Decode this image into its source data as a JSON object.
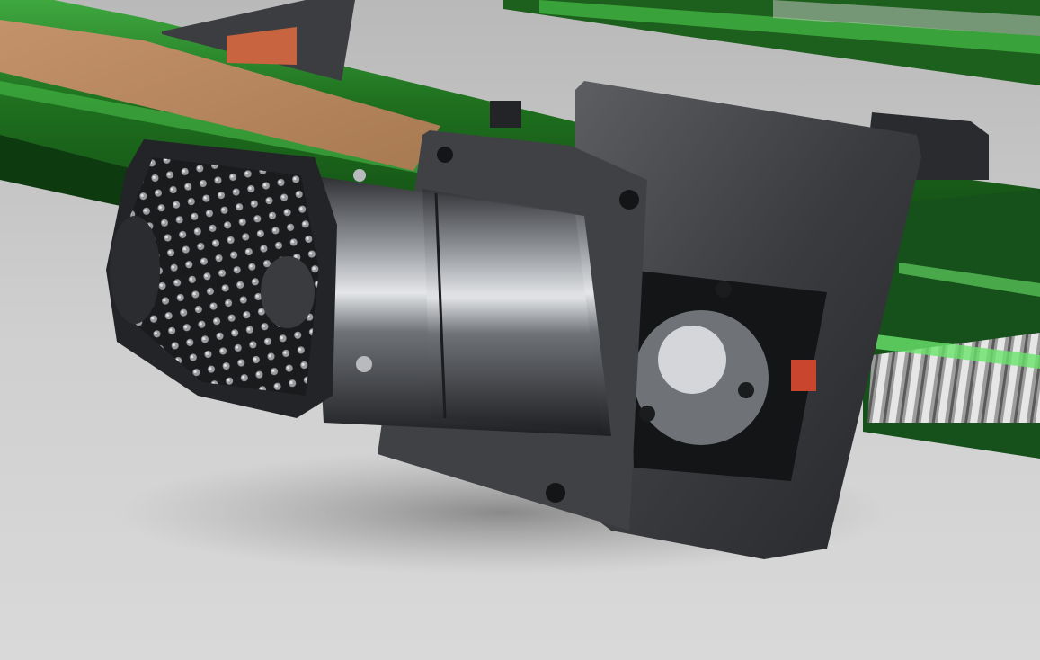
{
  "scene": {
    "subject": "servo-motor-with-heatsink-on-ballscrew-mount",
    "colors": {
      "floor": "#cfcfcf",
      "rail_green": "#1f7a1f",
      "rail_highlight": "#49c24a",
      "mdf": "#b9875a",
      "metal_dark": "#3a3a3d",
      "metal_light": "#cfd2d6",
      "accent_red": "#c9452e",
      "copper": "#c8643f"
    }
  }
}
